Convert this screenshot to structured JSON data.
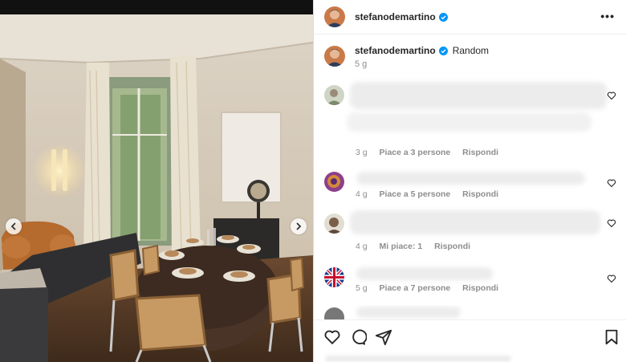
{
  "post": {
    "username": "stefanodemartino",
    "caption": "Random",
    "time": "5 g"
  },
  "header": {
    "more_label": "•••"
  },
  "icons": {
    "verified": "verified-badge-icon",
    "prev": "chevron-left-icon",
    "next": "chevron-right-icon",
    "like": "heart-icon",
    "comment": "comment-bubble-icon",
    "share": "paper-plane-icon",
    "save": "bookmark-icon"
  },
  "comments": [
    {
      "time": "3 g",
      "likes": "Piace a 3 persone",
      "reply": "Rispondi"
    },
    {
      "time": "4 g",
      "likes": "Piace a 5 persone",
      "reply": "Rispondi"
    },
    {
      "time": "4 g",
      "likes": "Mi piace: 1",
      "reply": "Rispondi"
    },
    {
      "time": "5 g",
      "likes": "Piace a 7 persone",
      "reply": "Rispondi"
    }
  ],
  "colors": {
    "accent": "#0095f6",
    "muted": "#8e8e8e",
    "text": "#262626"
  }
}
